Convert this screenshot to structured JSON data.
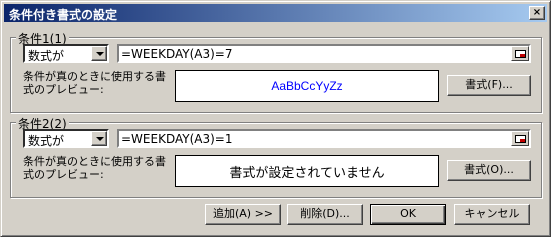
{
  "window": {
    "title": "条件付き書式の設定"
  },
  "conditions": [
    {
      "legend": "条件1(1)",
      "type_value": "数式が",
      "formula": "=WEEKDAY(A3)=7",
      "preview_label": "条件が真のときに使用する書式のプレビュー:",
      "preview_text": "AaBbCcYyZz",
      "preview_color": "#0000ff",
      "format_button": "書式(F)..."
    },
    {
      "legend": "条件2(2)",
      "type_value": "数式が",
      "formula": "=WEEKDAY(A3)=1",
      "preview_label": "条件が真のときに使用する書式のプレビュー:",
      "preview_text": "書式が設定されていません",
      "preview_color": "#000000",
      "format_button": "書式(O)..."
    }
  ],
  "buttons": {
    "add": "追加(A) >>",
    "delete": "削除(D)...",
    "ok": "OK",
    "cancel": "キャンセル"
  }
}
